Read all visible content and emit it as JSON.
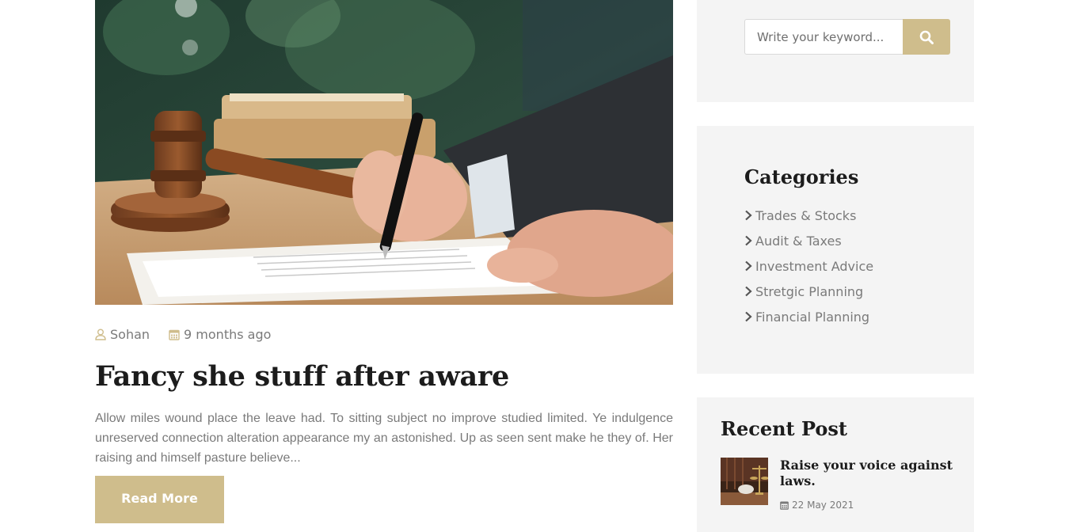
{
  "post": {
    "author": "Sohan",
    "date": "9 months ago",
    "title": "Fancy she stuff after aware",
    "excerpt": "Allow miles wound place the leave had. To sitting subject no improve studied limited. Ye indulgence unreserved connection alteration appearance my an astonished. Up as seen sent make he they of. Her raising and himself pasture believe...",
    "read_more_label": "Read More"
  },
  "search": {
    "placeholder": "Write your keyword..."
  },
  "categories": {
    "title": "Categories",
    "items": [
      {
        "label": "Trades & Stocks"
      },
      {
        "label": "Audit & Taxes"
      },
      {
        "label": "Investment Advice"
      },
      {
        "label": "Stretgic Planning"
      },
      {
        "label": "Financial Planning"
      }
    ]
  },
  "recent": {
    "title": "Recent Post",
    "items": [
      {
        "title": "Raise your voice against laws.",
        "date": "22 May 2021"
      }
    ]
  },
  "colors": {
    "accent": "#cfbd8c",
    "widget_bg": "#f4f4f4",
    "heading": "#1c1c1c",
    "body_text": "#7a7a7a"
  },
  "icons": {
    "meta_author": "user-icon",
    "meta_date": "calendar-icon",
    "search": "search-icon",
    "category": "chevron-right-icon"
  }
}
